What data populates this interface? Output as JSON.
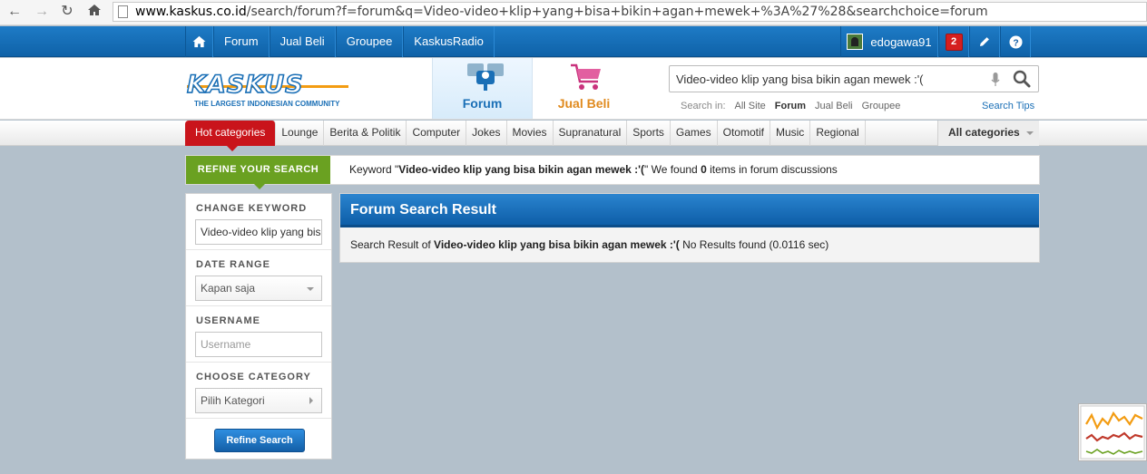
{
  "browser": {
    "url_domain": "www.kaskus.co.id",
    "url_path": "/search/forum?f=forum&q=Video-video+klip+yang+bisa+bikin+agan+mewek+%3A%27%28&searchchoice=forum"
  },
  "topbar": {
    "nav": [
      "Forum",
      "Jual Beli",
      "Groupee",
      "KaskusRadio"
    ],
    "username": "edogawa91",
    "notification_count": "2"
  },
  "header": {
    "logo_text": "KASKUS",
    "logo_tagline": "THE LARGEST INDONESIAN COMMUNITY",
    "tab_forum": "Forum",
    "tab_jualbeli": "Jual Beli",
    "search_value": "Video-video klip yang bisa bikin agan mewek :'(",
    "search_in_label": "Search in:",
    "search_in_options": [
      "All Site",
      "Forum",
      "Jual Beli",
      "Groupee"
    ],
    "search_tips": "Search Tips"
  },
  "categories": {
    "hot": "Hot categories",
    "items": [
      "Lounge",
      "Berita & Politik",
      "Computer",
      "Jokes",
      "Movies",
      "Supranatural",
      "Sports",
      "Games",
      "Otomotif",
      "Music",
      "Regional"
    ],
    "all": "All categories"
  },
  "refine": {
    "label": "REFINE YOUR SEARCH",
    "keyword_prefix": "Keyword \"",
    "keyword": "Video-video klip yang bisa bikin agan mewek :'(",
    "keyword_suffix": "\" We found ",
    "count": "0",
    "count_suffix": " items in forum discussions"
  },
  "sidebar": {
    "change_keyword_title": "CHANGE KEYWORD",
    "keyword_value": "Video-video klip yang bisa bikin agan mewek :'(",
    "date_range_title": "DATE RANGE",
    "date_range_value": "Kapan saja",
    "username_title": "USERNAME",
    "username_placeholder": "Username",
    "category_title": "CHOOSE CATEGORY",
    "category_value": "Pilih Kategori",
    "button": "Refine Search"
  },
  "results": {
    "title": "Forum Search Result",
    "prefix": "Search Result of ",
    "query": "Video-video klip yang bisa bikin agan mewek :'(",
    "suffix": " No Results found (0.0116 sec)"
  }
}
